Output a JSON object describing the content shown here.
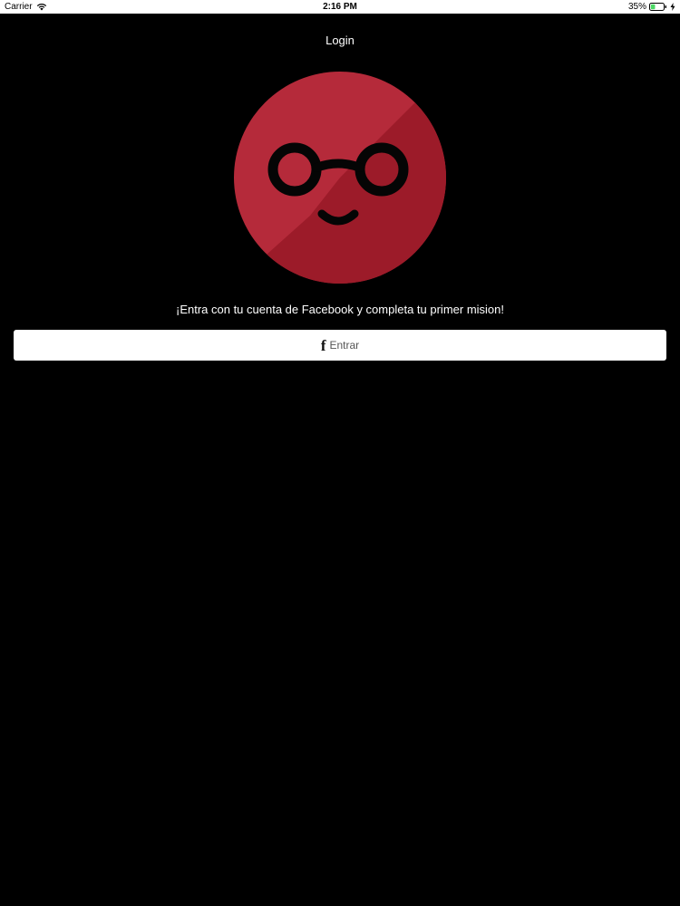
{
  "status_bar": {
    "carrier": "Carrier",
    "time": "2:16 PM",
    "battery": "35%",
    "battery_level": 0.35
  },
  "nav": {
    "title": "Login"
  },
  "logo": {
    "icon": "glasses-smiley-logo",
    "color": "#b52a3a",
    "shadow_color": "#991a28"
  },
  "prompt": {
    "text": "¡Entra con tu cuenta de Facebook y completa tu primer mision!"
  },
  "login_button": {
    "icon": "f",
    "label": "Entrar"
  }
}
